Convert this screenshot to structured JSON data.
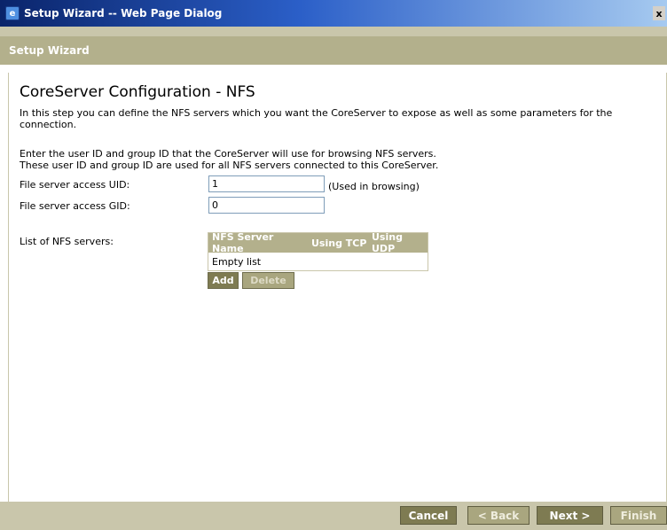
{
  "window": {
    "title": "Setup Wizard -- Web Page Dialog",
    "close_glyph": "x"
  },
  "header": {
    "title": "Setup Wizard"
  },
  "main": {
    "page_title": "CoreServer Configuration - NFS",
    "description": "In this step you can define the NFS servers which you want the CoreServer to expose as well as some parameters for the connection.",
    "instructions_line1": "Enter the user ID and group ID that the CoreServer will use for browsing NFS servers.",
    "instructions_line2": "These user ID and group ID are used for all NFS servers connected to this CoreServer.",
    "uid_label": "File server access UID:",
    "uid_value": "1",
    "uid_hint": "(Used in browsing)",
    "gid_label": "File server access GID:",
    "gid_value": "0",
    "nfs_list_label": "List of NFS servers:",
    "nfs_table": {
      "columns": [
        "NFS Server Name",
        "Using TCP",
        "Using UDP"
      ],
      "empty_text": "Empty list"
    },
    "add_label": "Add",
    "delete_label": "Delete"
  },
  "footer": {
    "cancel_label": "Cancel",
    "back_label": "< Back",
    "next_label": "Next >",
    "finish_label": "Finish"
  }
}
